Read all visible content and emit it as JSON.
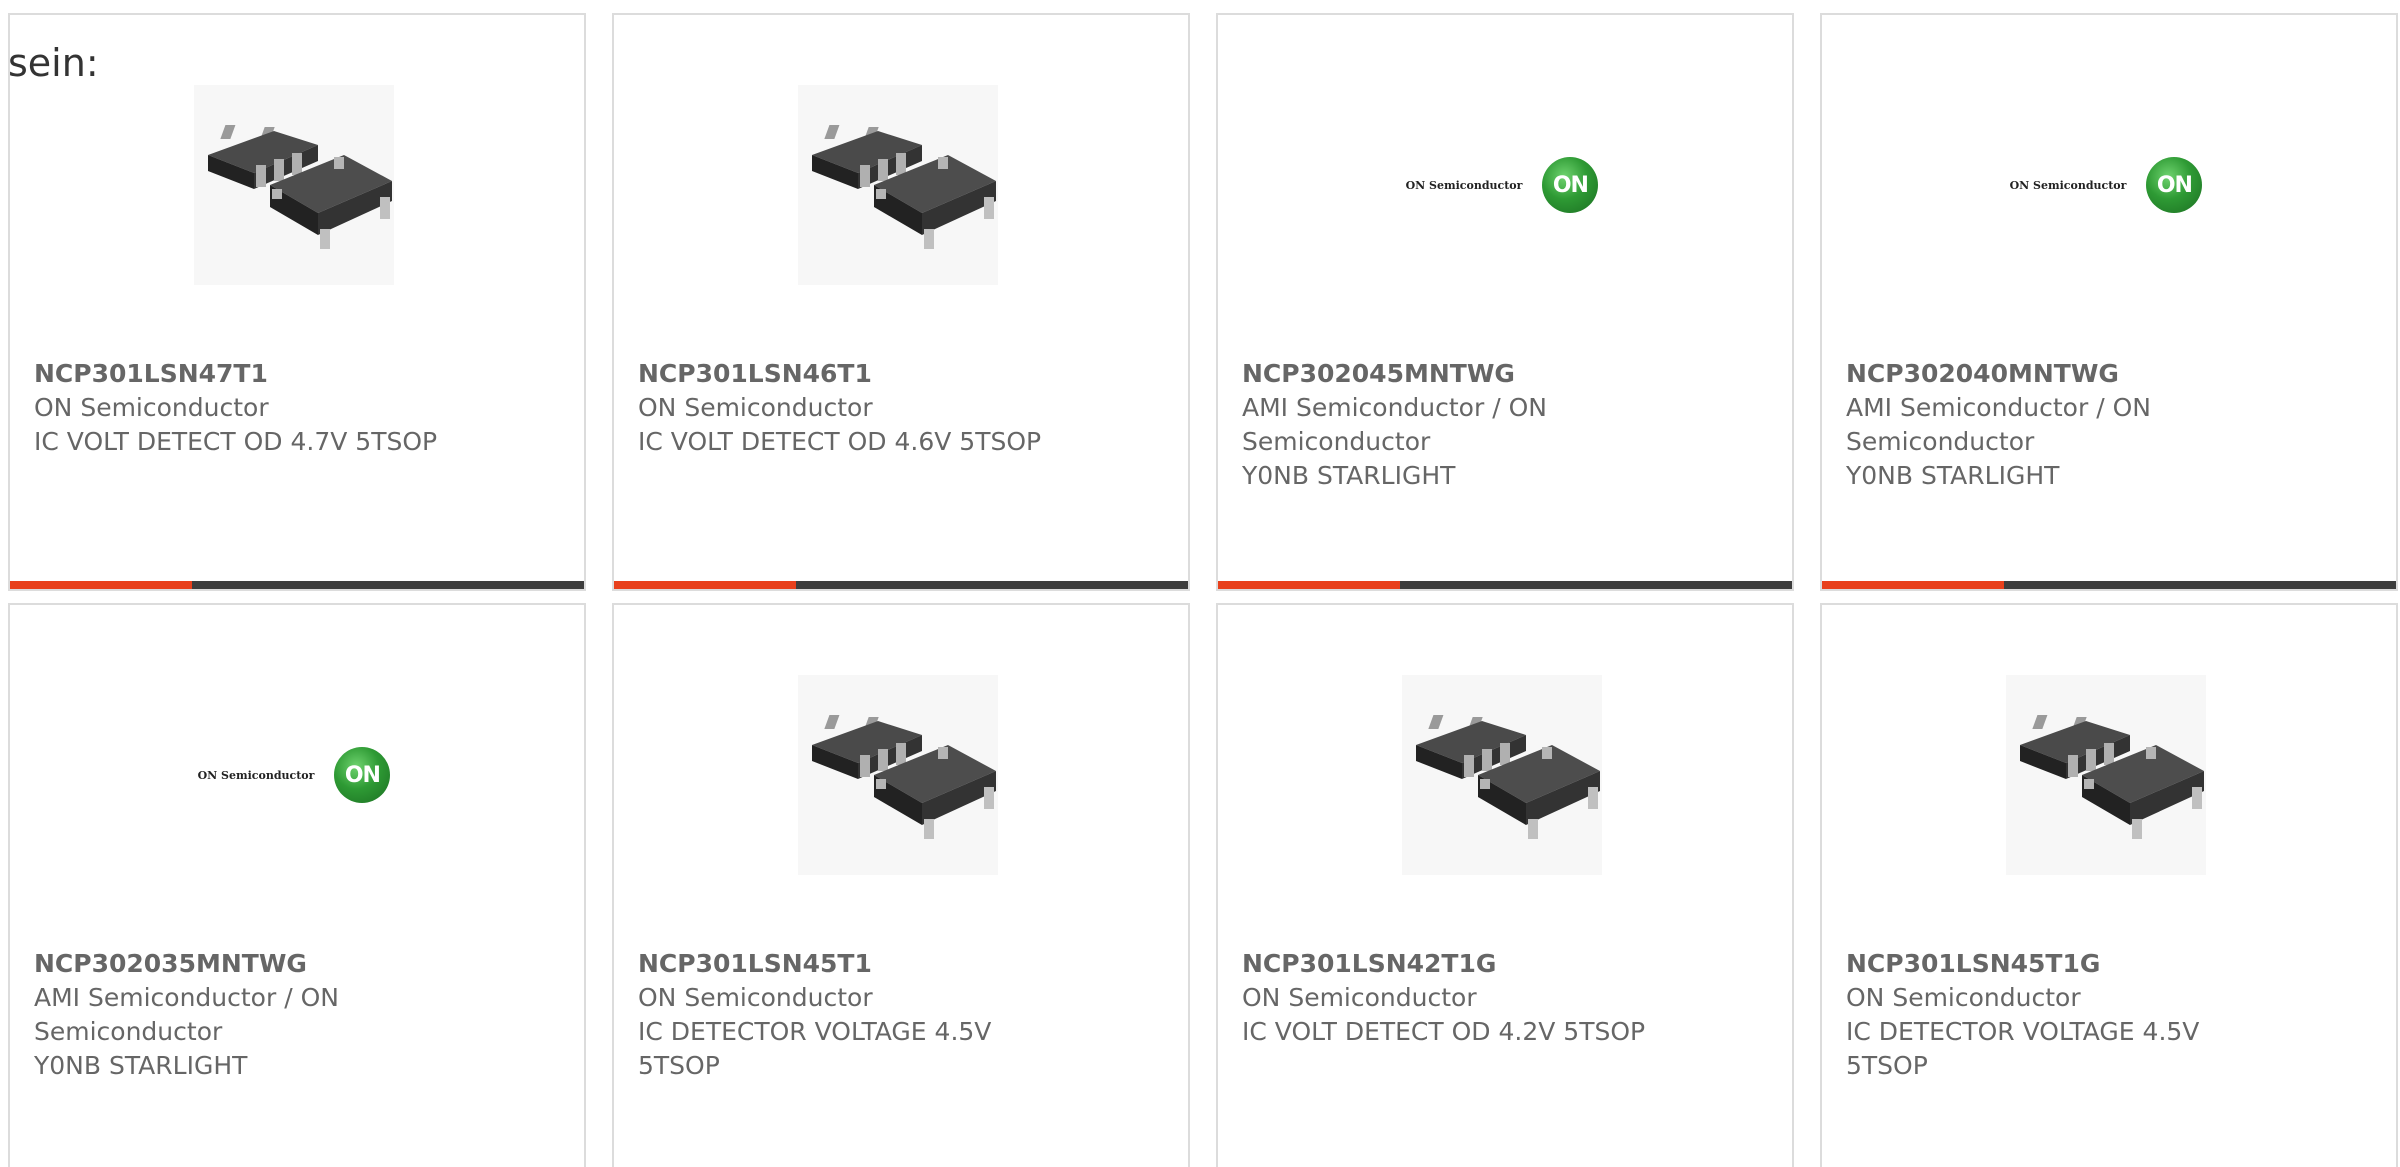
{
  "intro_text": "sein:",
  "accent_color": "#e8401c",
  "bar_color": "#3d3d3d",
  "products": [
    {
      "part_number": "NCP301LSN47T1",
      "manufacturer": "ON Semiconductor",
      "description": "IC VOLT DETECT OD 4.7V 5TSOP",
      "image": "chip-package-image"
    },
    {
      "part_number": "NCP301LSN46T1",
      "manufacturer": "ON Semiconductor",
      "description": "IC VOLT DETECT OD 4.6V 5TSOP",
      "image": "chip-package-image"
    },
    {
      "part_number": "NCP302045MNTWG",
      "manufacturer": "AMI Semiconductor / ON Semiconductor",
      "description": "Y0NB STARLIGHT",
      "image": "on-semiconductor-logo",
      "logo_text": "ON Semiconductor",
      "logo_mark": "ON"
    },
    {
      "part_number": "NCP302040MNTWG",
      "manufacturer": "AMI Semiconductor / ON Semiconductor",
      "description": "Y0NB STARLIGHT",
      "image": "on-semiconductor-logo",
      "logo_text": "ON Semiconductor",
      "logo_mark": "ON"
    },
    {
      "part_number": "NCP302035MNTWG",
      "manufacturer": "AMI Semiconductor / ON Semiconductor",
      "description": "Y0NB STARLIGHT",
      "image": "on-semiconductor-logo",
      "logo_text": "ON Semiconductor",
      "logo_mark": "ON"
    },
    {
      "part_number": "NCP301LSN45T1",
      "manufacturer": "ON Semiconductor",
      "description": "IC DETECTOR VOLTAGE 4.5V 5TSOP",
      "image": "chip-package-image"
    },
    {
      "part_number": "NCP301LSN42T1G",
      "manufacturer": "ON Semiconductor",
      "description": "IC VOLT DETECT OD 4.2V 5TSOP",
      "image": "chip-package-image"
    },
    {
      "part_number": "NCP301LSN45T1G",
      "manufacturer": "ON Semiconductor",
      "description": "IC DETECTOR VOLTAGE 4.5V 5TSOP",
      "image": "chip-package-image"
    }
  ]
}
